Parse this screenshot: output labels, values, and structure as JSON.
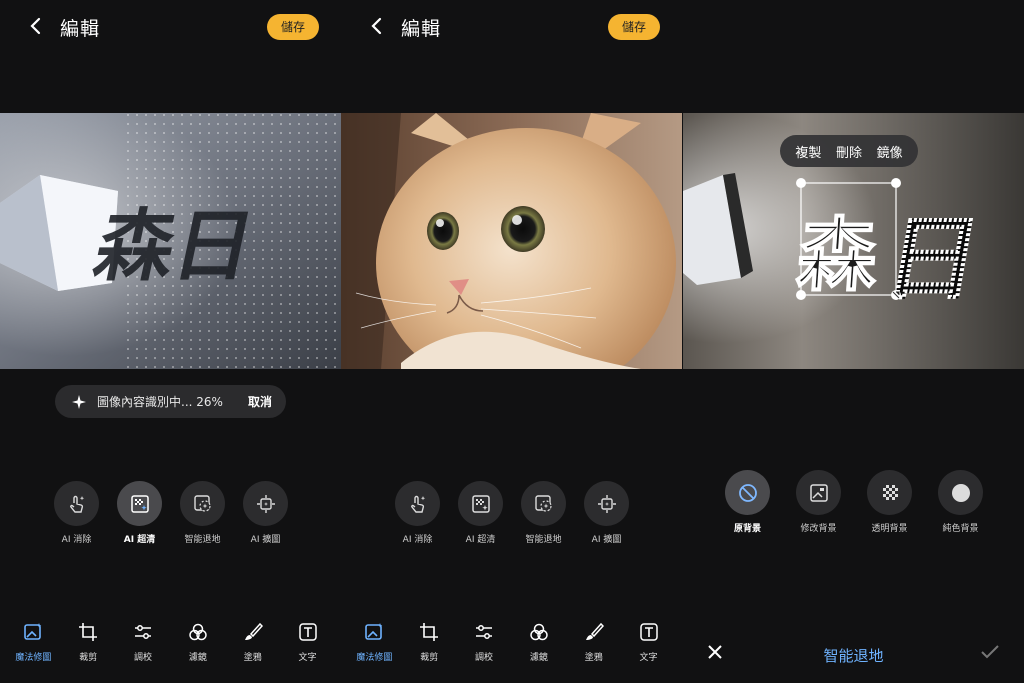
{
  "screens": [
    {
      "header": {
        "title": "編輯",
        "save_label": "儲存"
      },
      "progress": {
        "text": "圖像內容識別中... 26%",
        "cancel_label": "取消"
      },
      "ai_tools": [
        {
          "label": "AI 消除",
          "icon": "hand-sparkle-icon",
          "active": false
        },
        {
          "label": "AI 超清",
          "icon": "grid-sparkle-icon",
          "active": true
        },
        {
          "label": "智能退地",
          "icon": "cutout-sparkle-icon",
          "active": false
        },
        {
          "label": "AI 擴圖",
          "icon": "expand-icon",
          "active": false
        }
      ],
      "toolbar": [
        {
          "label": "魔法修圖",
          "icon": "magic-image-icon",
          "active": true
        },
        {
          "label": "裁剪",
          "icon": "crop-icon",
          "active": false
        },
        {
          "label": "調校",
          "icon": "sliders-icon",
          "active": false
        },
        {
          "label": "濾鏡",
          "icon": "filter-circles-icon",
          "active": false
        },
        {
          "label": "塗鴉",
          "icon": "brush-icon",
          "active": false
        },
        {
          "label": "文字",
          "icon": "text-icon",
          "active": false
        }
      ],
      "photo_text": "森日"
    },
    {
      "header": {
        "title": "編輯",
        "save_label": "儲存"
      },
      "ai_tools": [
        {
          "label": "AI 消除",
          "icon": "hand-sparkle-icon",
          "active": false
        },
        {
          "label": "AI 超清",
          "icon": "grid-sparkle-icon",
          "active": false
        },
        {
          "label": "智能退地",
          "icon": "cutout-sparkle-icon",
          "active": false
        },
        {
          "label": "AI 擴圖",
          "icon": "expand-icon",
          "active": false
        }
      ],
      "toolbar": [
        {
          "label": "魔法修圖",
          "icon": "magic-image-icon",
          "active": true
        },
        {
          "label": "裁剪",
          "icon": "crop-icon",
          "active": false
        },
        {
          "label": "調校",
          "icon": "sliders-icon",
          "active": false
        },
        {
          "label": "濾鏡",
          "icon": "filter-circles-icon",
          "active": false
        },
        {
          "label": "塗鴉",
          "icon": "brush-icon",
          "active": false
        },
        {
          "label": "文字",
          "icon": "text-icon",
          "active": false
        }
      ]
    },
    {
      "context_menu": [
        "複製",
        "刪除",
        "鏡像"
      ],
      "background_options": [
        {
          "label": "原背景",
          "icon": "no-symbol-icon",
          "active": true
        },
        {
          "label": "修改背景",
          "icon": "image-icon",
          "active": false
        },
        {
          "label": "透明背景",
          "icon": "checker-icon",
          "active": false
        },
        {
          "label": "純色背景",
          "icon": "solid-circle-icon",
          "active": false
        }
      ],
      "bottom": {
        "mode_label": "智能退地"
      },
      "photo_text": {
        "selected": "森",
        "other": "日"
      }
    }
  ],
  "colors": {
    "accent": "#f5b431",
    "active_blue": "#6fb3ff",
    "background": "#111112"
  }
}
